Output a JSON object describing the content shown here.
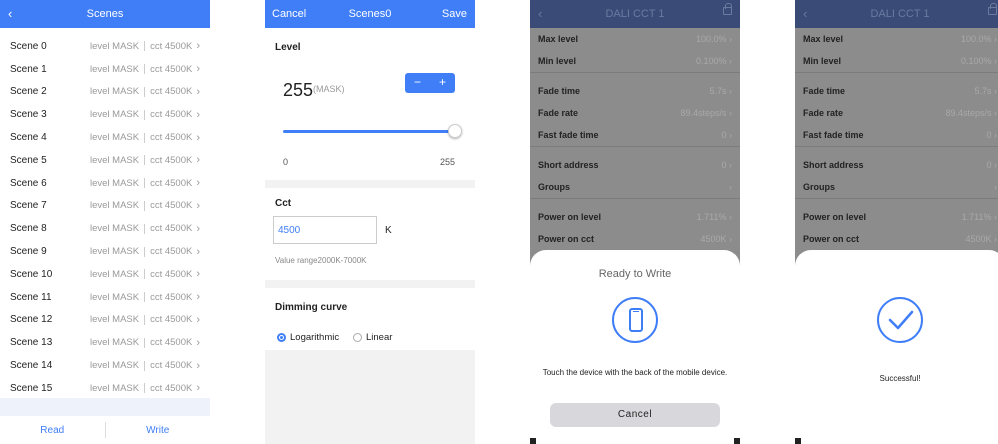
{
  "screen1": {
    "title": "Scenes",
    "back_icon": "chevron-left-icon",
    "scenes": [
      {
        "name": "Scene 0",
        "level": "level MASK",
        "cct": "cct 4500K"
      },
      {
        "name": "Scene 1",
        "level": "level MASK",
        "cct": "cct 4500K"
      },
      {
        "name": "Scene 2",
        "level": "level MASK",
        "cct": "cct 4500K"
      },
      {
        "name": "Scene 3",
        "level": "level MASK",
        "cct": "cct 4500K"
      },
      {
        "name": "Scene 4",
        "level": "level MASK",
        "cct": "cct 4500K"
      },
      {
        "name": "Scene 5",
        "level": "level MASK",
        "cct": "cct 4500K"
      },
      {
        "name": "Scene 6",
        "level": "level MASK",
        "cct": "cct 4500K"
      },
      {
        "name": "Scene 7",
        "level": "level MASK",
        "cct": "cct 4500K"
      },
      {
        "name": "Scene 8",
        "level": "level MASK",
        "cct": "cct 4500K"
      },
      {
        "name": "Scene 9",
        "level": "level MASK",
        "cct": "cct 4500K"
      },
      {
        "name": "Scene 10",
        "level": "level MASK",
        "cct": "cct 4500K"
      },
      {
        "name": "Scene 11",
        "level": "level MASK",
        "cct": "cct 4500K"
      },
      {
        "name": "Scene 12",
        "level": "level MASK",
        "cct": "cct 4500K"
      },
      {
        "name": "Scene 13",
        "level": "level MASK",
        "cct": "cct 4500K"
      },
      {
        "name": "Scene 14",
        "level": "level MASK",
        "cct": "cct 4500K"
      },
      {
        "name": "Scene 15",
        "level": "level MASK",
        "cct": "cct 4500K"
      }
    ],
    "read_label": "Read",
    "write_label": "Write"
  },
  "screen2": {
    "cancel_label": "Cancel",
    "title": "Scenes0",
    "save_label": "Save",
    "level_title": "Level",
    "level_value": "255",
    "level_mask": "(MASK)",
    "minus": "−",
    "plus": "+",
    "slider_fraction": 1.0,
    "range_min": "0",
    "range_max": "255",
    "cct_title": "Cct",
    "cct_value": "4500",
    "cct_unit": "K",
    "cct_hint": "Value range2000K-7000K",
    "dimming_title": "Dimming curve",
    "option_log": "Logarithmic",
    "option_linear": "Linear",
    "selected_option": "Logarithmic"
  },
  "screen3": {
    "title": "DALI CCT 1",
    "lock_icon": "lock-icon",
    "settings": [
      {
        "label": "Max level",
        "value": "100.0%"
      },
      {
        "label": "Min level",
        "value": "0.100%"
      },
      {
        "label": "Fade time",
        "value": "5.7s"
      },
      {
        "label": "Fade rate",
        "value": "89.4steps/s"
      },
      {
        "label": "Fast fade time",
        "value": "0"
      },
      {
        "label": "Short address",
        "value": "0"
      },
      {
        "label": "Groups",
        "value": ""
      },
      {
        "label": "Power on level",
        "value": "1.711%"
      },
      {
        "label": "Power on cct",
        "value": "4500K"
      }
    ],
    "sheet_title": "Ready to Write",
    "sheet_icon": "phone-icon",
    "sheet_message": "Touch the device with the back of the mobile device.",
    "cancel_label": "Cancel"
  },
  "screen4": {
    "title": "DALI CCT 1",
    "settings": [
      {
        "label": "Max level",
        "value": "100.0%"
      },
      {
        "label": "Min level",
        "value": "0.100%"
      },
      {
        "label": "Fade time",
        "value": "5.7s"
      },
      {
        "label": "Fade rate",
        "value": "89.4steps/s"
      },
      {
        "label": "Fast fade time",
        "value": "0"
      },
      {
        "label": "Short address",
        "value": "0"
      },
      {
        "label": "Groups",
        "value": ""
      },
      {
        "label": "Power on level",
        "value": "1.711%"
      },
      {
        "label": "Power on cct",
        "value": "4500K"
      }
    ],
    "sheet_icon": "check-circle-icon",
    "success_message": "Successful!"
  },
  "colors": {
    "accent": "#3f7ef7",
    "dim_overlay": "#8c8c8c",
    "dim_header": "#3a4b78"
  }
}
